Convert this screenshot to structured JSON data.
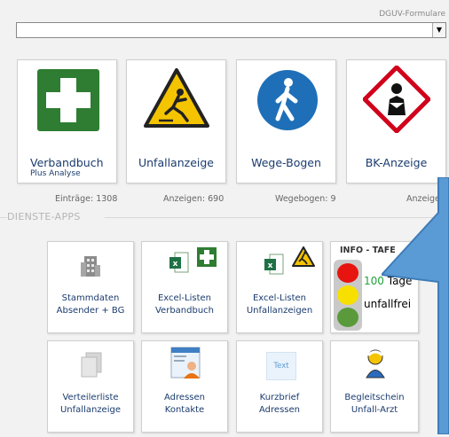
{
  "header": {
    "label": "DGUV-Formulare",
    "combo_value": ""
  },
  "top_tiles": [
    {
      "label": "Verbandbuch",
      "sublabel": "Plus Analyse",
      "stat": "Einträge: 1308"
    },
    {
      "label": "Unfallanzeige",
      "stat": "Anzeigen: 690"
    },
    {
      "label": "Wege-Bogen",
      "stat": "Wegebogen: 9"
    },
    {
      "label": "BK-Anzeige",
      "stat": "Anzeige"
    }
  ],
  "section_label": "DIENSTE-APPS",
  "apps": [
    {
      "line1": "Stammdaten",
      "line2": "Absender + BG"
    },
    {
      "line1": "Excel-Listen",
      "line2": "Verbandbuch"
    },
    {
      "line1": "Excel-Listen",
      "line2": "Unfallanzeigen"
    },
    {
      "line1": "Verteilerliste",
      "line2": "Unfallanzeige"
    },
    {
      "line1": "Adressen",
      "line2": "Kontakte"
    },
    {
      "line1": "Kurzbrief",
      "line2": "Adressen"
    },
    {
      "line1": "Begleitschein",
      "line2": "Unfall-Arzt"
    }
  ],
  "info": {
    "title": "INFO - TAFE",
    "days": "100",
    "days_unit": "Tage",
    "status": "unfallfrei"
  },
  "icon_text": "Text",
  "colors": {
    "first_aid_green": "#2e7d32",
    "accent_blue": "#5b9bd5",
    "label_navy": "#1a3b6e",
    "warning_yellow": "#f5c400"
  }
}
